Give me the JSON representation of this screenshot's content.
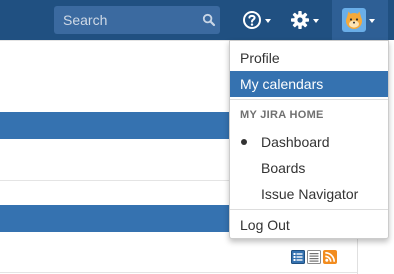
{
  "colors": {
    "header_bg": "#205081",
    "search_bg": "#3b6aa0",
    "accent": "#3572b0",
    "menu_active_bg": "#3572b0",
    "rss_orange": "#f28c1f"
  },
  "header": {
    "search": {
      "placeholder": "Search",
      "icon": "magnifier-icon"
    },
    "help": {
      "icon": "help-circle-icon"
    },
    "settings": {
      "icon": "gear-icon"
    },
    "user": {
      "icon": "user-avatar-icon"
    }
  },
  "user_menu": {
    "items": [
      {
        "label": "Profile"
      },
      {
        "label": "My calendars",
        "highlighted": true
      }
    ],
    "section": {
      "title": "MY JIRA HOME",
      "items": [
        {
          "label": "Dashboard",
          "selected": true
        },
        {
          "label": "Boards"
        },
        {
          "label": "Issue Navigator"
        }
      ]
    },
    "logout": {
      "label": "Log Out"
    }
  },
  "page": {
    "footer_icons": [
      "list-view-icon",
      "detail-view-icon",
      "rss-icon"
    ]
  }
}
